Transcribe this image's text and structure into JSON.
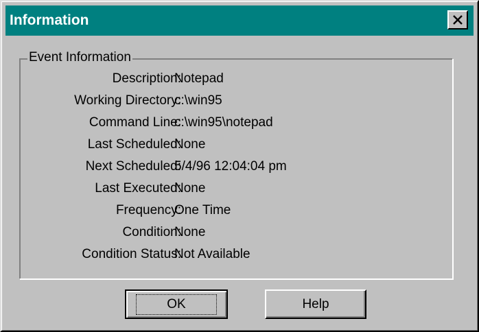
{
  "window": {
    "title": "Information",
    "close_symbol": "✕"
  },
  "group": {
    "legend": "Event Information"
  },
  "fields": [
    {
      "label": "Description:",
      "value": "Notepad"
    },
    {
      "label": "Working Directory:",
      "value": "c:\\win95"
    },
    {
      "label": "Command Line:",
      "value": "c:\\win95\\notepad"
    },
    {
      "label": "Last Scheduled:",
      "value": "None"
    },
    {
      "label": "Next Scheduled:",
      "value": "5/4/96 12:04:04 pm"
    },
    {
      "label": "Last Executed:",
      "value": "None"
    },
    {
      "label": "Frequency:",
      "value": "One Time"
    },
    {
      "label": "Condition:",
      "value": "None"
    },
    {
      "label": "Condition Status:",
      "value": "Not Available"
    }
  ],
  "buttons": {
    "ok_label": "OK",
    "help_label": "Help"
  },
  "colors": {
    "titlebar": "#008080",
    "face": "#c0c0c0"
  }
}
